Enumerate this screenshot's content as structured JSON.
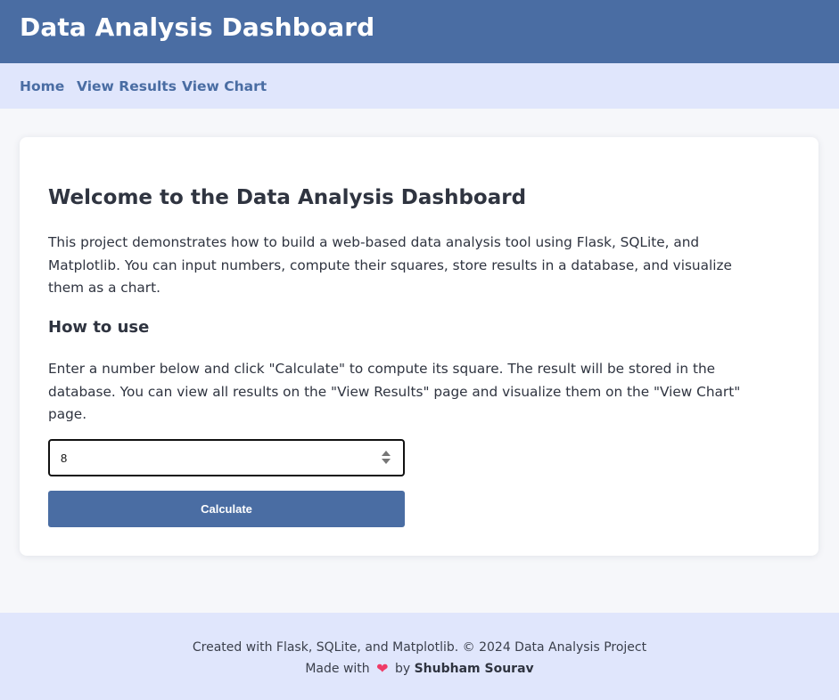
{
  "header": {
    "title": "Data Analysis Dashboard"
  },
  "nav": {
    "home": "Home",
    "view_results": "View Results",
    "view_chart": "View Chart"
  },
  "main": {
    "heading": "Welcome to the Data Analysis Dashboard",
    "intro": "This project demonstrates how to build a web-based data analysis tool using Flask, SQLite, and Matplotlib. You can input numbers, compute their squares, store results in a database, and visualize them as a chart.",
    "howto_heading": "How to use",
    "instructions": "Enter a number below and click \"Calculate\" to compute its square. The result will be stored in the database. You can view all results on the \"View Results\" page and visualize them on the \"View Chart\" page.",
    "number_value": "8",
    "calculate_label": "Calculate"
  },
  "footer": {
    "credits": "Created with Flask, SQLite, and Matplotlib. © 2024 Data Analysis Project",
    "made_with": "Made with",
    "heart_icon": "heart-icon",
    "by": "by",
    "author": "Shubham Sourav"
  },
  "colors": {
    "brand": "#4a6da3",
    "nav_bg": "#e0e6fc",
    "page_bg": "#f6f7fa",
    "heart": "#ef3b67"
  }
}
